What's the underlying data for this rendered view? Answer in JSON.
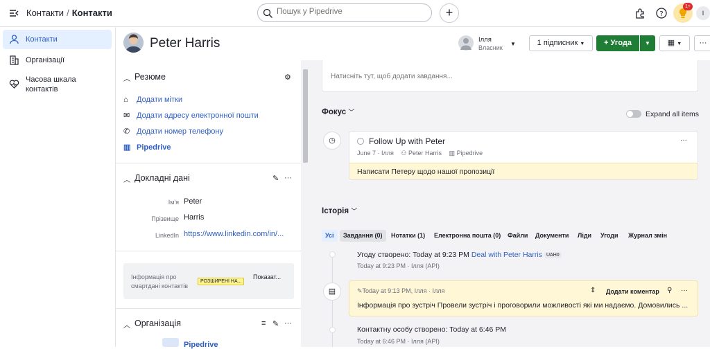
{
  "topbar": {
    "breadcrumb_parent": "Контакти",
    "breadcrumb_sep": "/",
    "breadcrumb_current": "Контакти",
    "search_placeholder": "Пошук у Pipedrive",
    "notif_badge": "1+",
    "user_initial": "І"
  },
  "sidebar": {
    "items": [
      {
        "label": "Контакти",
        "icon": "person-icon",
        "active": true
      },
      {
        "label": "Організації",
        "icon": "building-icon",
        "active": false
      },
      {
        "label": "Часова шкала контактів",
        "icon": "heart-pulse-icon",
        "active": false
      }
    ]
  },
  "header": {
    "person_name": "Peter Harris",
    "owner_name": "Ілля",
    "owner_role": "Власник",
    "follower_label": "1 підписник",
    "deal_label": "+ Угода",
    "more": "···"
  },
  "summary": {
    "title": "Резюме",
    "links": [
      {
        "label": "Додати мітки",
        "icon": "tag-icon"
      },
      {
        "label": "Додати адресу електронної пошти",
        "icon": "mail-icon"
      },
      {
        "label": "Додати номер телефону",
        "icon": "phone-icon"
      },
      {
        "label": "Pipedrive",
        "icon": "building-icon"
      }
    ]
  },
  "details": {
    "title": "Докладні дані",
    "fields": [
      {
        "label": "Ім'я",
        "value": "Peter"
      },
      {
        "label": "Прізвище",
        "value": "Harris"
      },
      {
        "label": "LinkedIn",
        "value": "https://www.linkedin.com/in/..."
      }
    ]
  },
  "smart": {
    "label": "Інформація про смартдані контактів",
    "badge": "РОЗШИРЕНІ НА...",
    "show": "Показат..."
  },
  "organization": {
    "title": "Організація",
    "name": "Pipedrive"
  },
  "main": {
    "task_placeholder": "Натисніть тут, щоб додати завдання...",
    "focus_title": "Фокус",
    "expand_label": "Expand all items",
    "focus_item": {
      "title": "Follow Up with Peter",
      "date": "June 7 · Ілля",
      "person": "Peter Harris",
      "org": "Pipedrive",
      "note": "Написати Петеру щодо нашої пропозиції"
    },
    "history_title": "Історія",
    "tabs": [
      "Усі",
      "Завдання (0)",
      "Нотатки (1)",
      "Електронна пошта (0)",
      "Файли",
      "Документи",
      "Ліди",
      "Угоди",
      "Журнал змін"
    ],
    "history": [
      {
        "prefix": "Угоду створено: Today at 9:23 PM ",
        "link": "Deal with Peter Harris",
        "badge": "UAH0",
        "meta": "Today at 9:23 PM · Ілля (API)"
      },
      {
        "meta": "Today at 9:13 PM, Ілля · Ілля",
        "action": "Додати коментар",
        "text": "Інформація про зустріч Провели зустріч і проговорили можливості які ми надаємо. Домовились ..."
      },
      {
        "prefix": "Контактну особу створено: Today at 6:46 PM",
        "meta": "Today at 6:46 PM · Ілля (API)"
      }
    ]
  }
}
